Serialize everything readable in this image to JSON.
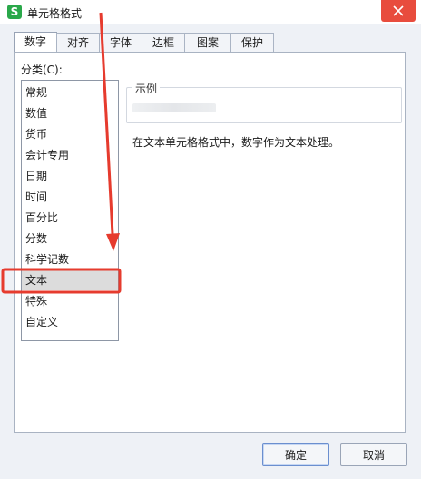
{
  "window": {
    "icon_letter": "S",
    "title": "单元格格式"
  },
  "tabs": [
    {
      "label": "数字",
      "active": true
    },
    {
      "label": "对齐"
    },
    {
      "label": "字体"
    },
    {
      "label": "边框"
    },
    {
      "label": "图案"
    },
    {
      "label": "保护"
    }
  ],
  "category": {
    "label": "分类(C):",
    "items": [
      "常规",
      "数值",
      "货币",
      "会计专用",
      "日期",
      "时间",
      "百分比",
      "分数",
      "科学记数",
      "文本",
      "特殊",
      "自定义"
    ],
    "selected": "文本"
  },
  "sample": {
    "label": "示例"
  },
  "description": "在文本单元格格式中，数字作为文本处理。",
  "buttons": {
    "ok": "确定",
    "cancel": "取消"
  },
  "colors": {
    "annotation": "#e63b2e",
    "close": "#e84c3d",
    "app_icon": "#2aa84a"
  }
}
